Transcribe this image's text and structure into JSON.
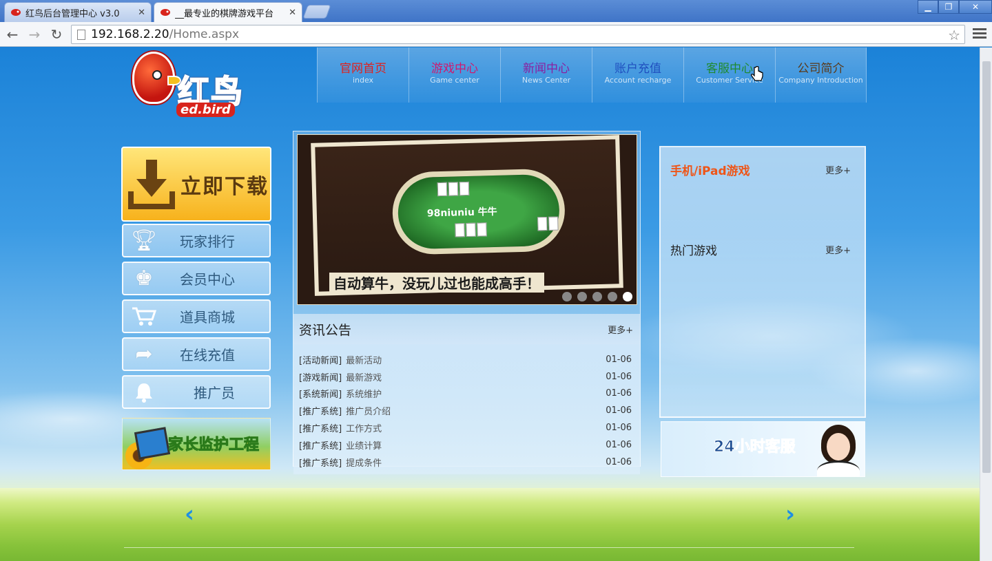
{
  "browser": {
    "tabs": [
      {
        "title": "红鸟后台管理中心 v3.0",
        "active": false
      },
      {
        "title": "__最专业的棋牌游戏平台",
        "active": true
      }
    ],
    "url_host": "192.168.2.20",
    "url_path": "/Home.aspx",
    "window_controls": [
      "minimize-icon",
      "restore-icon",
      "close-icon"
    ]
  },
  "logo": {
    "name_cn": "红鸟",
    "name_en": "ed.bird",
    "letter": "R"
  },
  "nav": [
    {
      "cn": "官网首页",
      "en": "index",
      "color": "#e0201c"
    },
    {
      "cn": "游戏中心",
      "en": "Game center",
      "color": "#d0186e"
    },
    {
      "cn": "新闻中心",
      "en": "News Center",
      "color": "#8a1fa0"
    },
    {
      "cn": "账户充值",
      "en": "Account recharge",
      "color": "#1f4fbf"
    },
    {
      "cn": "客服中心",
      "en": "Customer Service",
      "color": "#1f8a30"
    },
    {
      "cn": "公司简介",
      "en": "Company Introduction",
      "color": "#5a3a1a"
    }
  ],
  "sidebar": {
    "download_label": "立即下载",
    "items": [
      {
        "label": "玩家排行",
        "icon": "trophy-icon"
      },
      {
        "label": "会员中心",
        "icon": "crown-icon"
      },
      {
        "label": "道具商城",
        "icon": "cart-icon"
      },
      {
        "label": "在线充值",
        "icon": "arrow-right-icon"
      },
      {
        "label": "推广员",
        "icon": "bell-icon"
      }
    ],
    "guard_label": "家长监护工程"
  },
  "banner": {
    "caption": "自动算牛，没玩儿过也能成高手！",
    "table_text": "98niuniu 牛牛",
    "slide_count": 5,
    "active_slide": 5
  },
  "news": {
    "title": "资讯公告",
    "more": "更多+",
    "items": [
      {
        "category": "[活动新闻]",
        "title": "最新活动",
        "date": "01-06"
      },
      {
        "category": "[游戏新闻]",
        "title": "最新游戏",
        "date": "01-06"
      },
      {
        "category": "[系统新闻]",
        "title": "系统维护",
        "date": "01-06"
      },
      {
        "category": "[推广系统]",
        "title": "推广员介绍",
        "date": "01-06"
      },
      {
        "category": "[推广系统]",
        "title": "工作方式",
        "date": "01-06"
      },
      {
        "category": "[推广系统]",
        "title": "业绩计算",
        "date": "01-06"
      },
      {
        "category": "[推广系统]",
        "title": "提成条件",
        "date": "01-06"
      }
    ]
  },
  "right": {
    "mobile_title": "手机/iPad游戏",
    "mobile_more": "更多+",
    "hot_title": "热门游戏",
    "hot_more": "更多+",
    "service_label": "24小时客服"
  },
  "carousel": {
    "prev": "‹",
    "next": "›"
  }
}
